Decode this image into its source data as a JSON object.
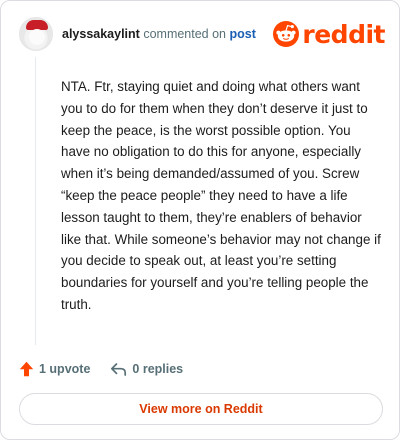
{
  "header": {
    "username": "alyssakaylint",
    "action_text": "commented on",
    "post_link": "post",
    "logo_text": "reddit"
  },
  "comment": {
    "body": "NTA. Ftr, staying quiet and doing what others want you to do for them when they don’t deserve it just to keep the peace, is the worst possible option. You have no obligation to do this for anyone, especially when it’s being demanded/assumed of you. Screw “keep the peace people” they need to have a life lesson taught to them, they’re enablers of behavior like that. While someone’s behavior may not change if you decide to speak out, at least you’re setting boundaries for yourself and you’re telling people the truth."
  },
  "actions": {
    "upvote_label": "1 upvote",
    "replies_label": "0 replies"
  },
  "footer": {
    "view_more_label": "View more on Reddit"
  },
  "colors": {
    "brand": "#ff4500",
    "link": "#1a5fb4",
    "muted": "#576f76",
    "view_more_text": "#d93900"
  },
  "icons": {
    "avatar": "avatar",
    "logo": "reddit-snoo-icon",
    "upvote": "upvote-arrow-icon",
    "reply": "reply-arrow-icon"
  }
}
